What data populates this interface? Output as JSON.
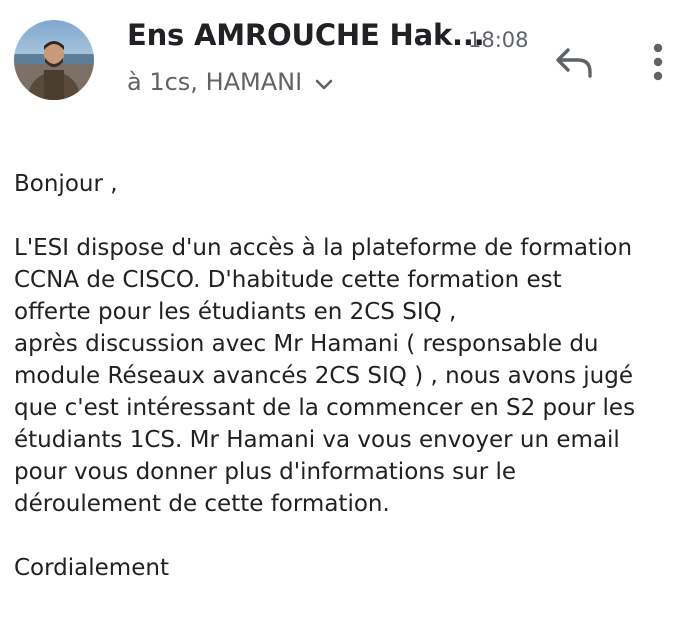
{
  "header": {
    "sender": "Ens AMROUCHE Hak...",
    "time": "18:08",
    "recipients": "à 1cs, HAMANI",
    "icons": {
      "avatar": "avatar",
      "expand": "chevron-down-icon",
      "reply": "reply-icon",
      "more": "more-vert-icon"
    }
  },
  "email": {
    "greeting": "Bonjour ,",
    "paragraph_lines": [
      "L'ESI dispose d'un accès à la plateforme de  formation",
      "CCNA de CISCO. D'habitude cette formation est",
      "offerte pour les étudiants en 2CS SIQ ,",
      "après discussion avec Mr Hamani ( responsable du",
      "module Réseaux avancés 2CS SIQ ) , nous avons jugé",
      "que c'est intéressant de la commencer en S2 pour les",
      "étudiants 1CS. Mr Hamani va vous envoyer un email",
      "pour vous donner plus d'informations sur le",
      "déroulement de cette formation."
    ],
    "closing": "Cordialement"
  },
  "colors": {
    "text": "#202124",
    "secondary": "#5f6368",
    "background": "#ffffff"
  }
}
